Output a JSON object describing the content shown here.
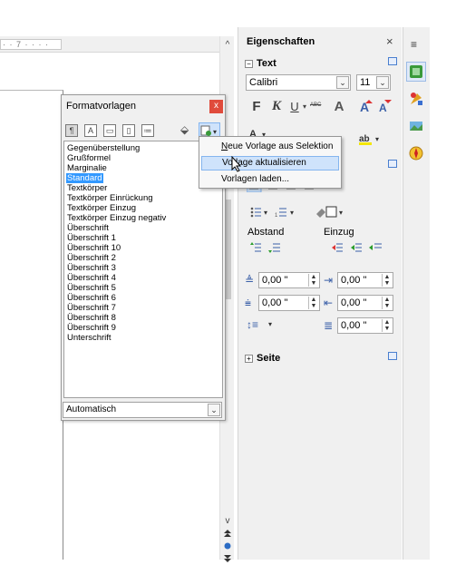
{
  "document": {
    "ruler_text": "· · 7 · · · ·",
    "scroll_up": "^",
    "scroll_down": "v"
  },
  "sidebar": {
    "title": "Eigenschaften",
    "close": "×",
    "tab_menu": "≡",
    "text_panel": {
      "title": "Text",
      "font_name": "Calibri",
      "font_size": "11",
      "bold": "F",
      "italic": "K",
      "underline": "U",
      "strike": "ABC",
      "shadow": "A"
    },
    "paragraph_panel": {
      "spacing_label": "Abstand",
      "indent_label": "Einzug",
      "above_spacing": "0,00 \"",
      "below_spacing": "0,00 \"",
      "before_indent": "0,00 \"",
      "after_indent": "0,00 \"",
      "first_line_indent": "0,00 \""
    },
    "page_panel": {
      "title": "Seite"
    }
  },
  "styles_window": {
    "title": "Formatvorlagen",
    "close": "x",
    "items": [
      "Gegenüberstellung",
      "Grußformel",
      "Marginalie",
      "Standard",
      "Textkörper",
      "Textkörper Einrückung",
      "Textkörper Einzug",
      "Textkörper Einzug negativ",
      "Überschrift",
      "Überschrift 1",
      "Überschrift 10",
      "Überschrift 2",
      "Überschrift 3",
      "Überschrift 4",
      "Überschrift 5",
      "Überschrift 6",
      "Überschrift 7",
      "Überschrift 8",
      "Überschrift 9",
      "Unterschrift"
    ],
    "selected_index": 3,
    "filter": "Automatisch"
  },
  "menu": {
    "items": [
      "Neue Vorlage aus Selektion",
      "Vorlage aktualisieren",
      "Vorlagen laden..."
    ],
    "highlighted_index": 1
  },
  "colors": {
    "selection": "#3399ff",
    "menu_highlight": "#cfe3fb",
    "close_red": "#e04b3c"
  }
}
